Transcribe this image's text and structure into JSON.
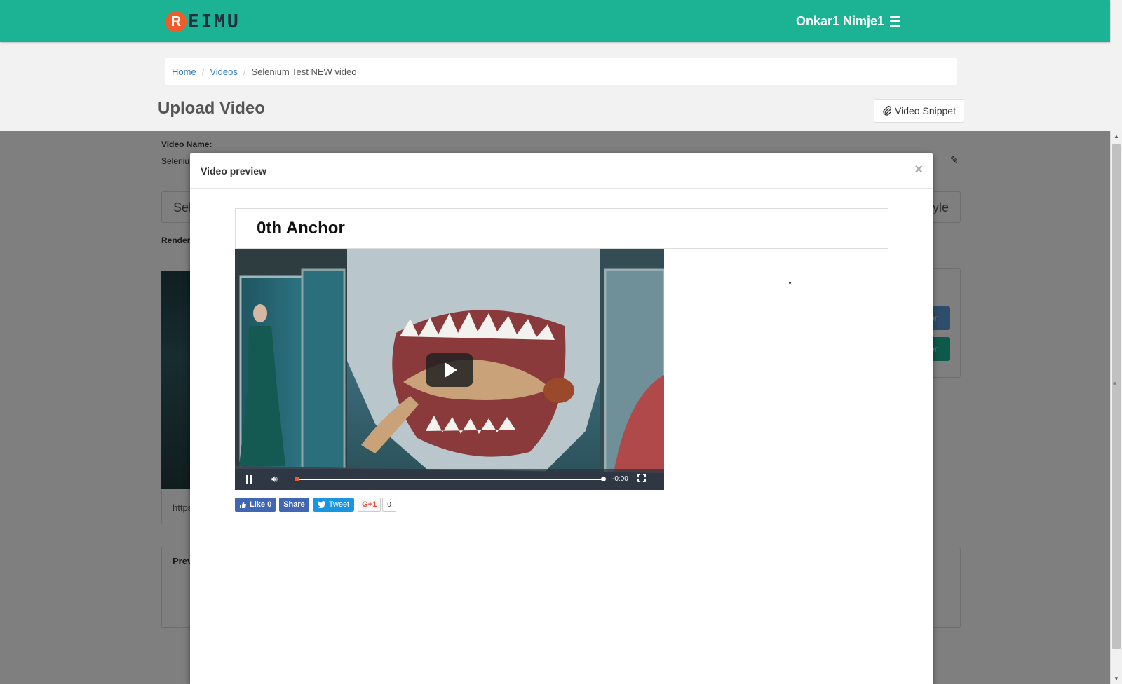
{
  "header": {
    "logo_letter": "R",
    "logo_text": "EIMU",
    "user_name": "Onkar1 Nimje1",
    "menu_icon": "hamburger-icon",
    "bg_color": "#1bb394"
  },
  "breadcrumb": {
    "home": "Home",
    "videos": "Videos",
    "current": "Selenium Test NEW video"
  },
  "page": {
    "title": "Upload Video",
    "snippet_button": "Video Snippet",
    "snippet_icon": "paperclip-icon"
  },
  "background": {
    "video_name_label": "Video Name:",
    "video_name_value": "Seleniu",
    "panel_left_text": "Sel",
    "panel_right_text": "yle",
    "render_label": "Render",
    "url_text": "https",
    "btn_blue_text": "or",
    "btn_teal_text": "or",
    "preview_header": "Prev"
  },
  "modal": {
    "title": "Video preview",
    "close_label": "×",
    "anchor_title": "0th Anchor",
    "player": {
      "time": "-0:00",
      "progress": 0
    },
    "share": {
      "fb_like": "Like 0",
      "fb_share": "Share",
      "tweet": "Tweet",
      "gplus": "G+1",
      "gplus_count": "0"
    }
  }
}
